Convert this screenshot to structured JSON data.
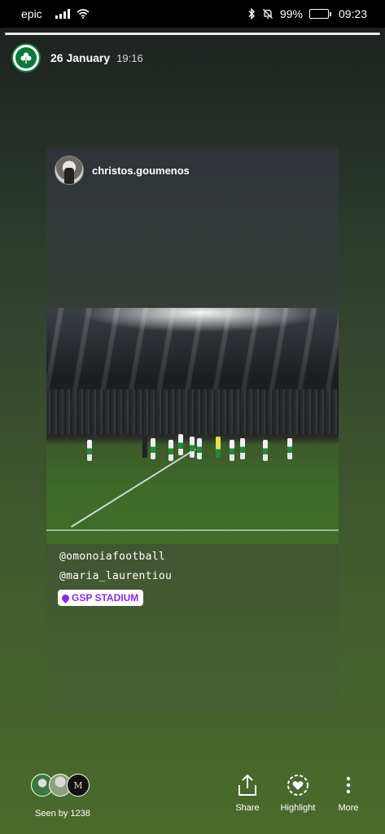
{
  "status_bar": {
    "carrier": "epic",
    "battery_text": "99%",
    "battery_level": 0.99,
    "time": "09:23"
  },
  "story": {
    "progress": 1.0,
    "date": "26 January",
    "time": "19:16"
  },
  "reshared_post": {
    "username": "christos.goumenos",
    "mentions": [
      "@omonoiafootball",
      "@maria_laurentiou"
    ],
    "location": "GSP STADIUM"
  },
  "footer": {
    "seen_by": "Seen by 1238",
    "share_label": "Share",
    "highlight_label": "Highlight",
    "more_label": "More"
  },
  "icons": {
    "signal": "signal-icon",
    "wifi": "wifi-icon",
    "bluetooth": "bluetooth-icon",
    "mute": "bell-off-icon",
    "battery": "battery-icon",
    "share": "share-icon",
    "highlight": "heart-circle-icon",
    "more": "more-vertical-icon"
  }
}
